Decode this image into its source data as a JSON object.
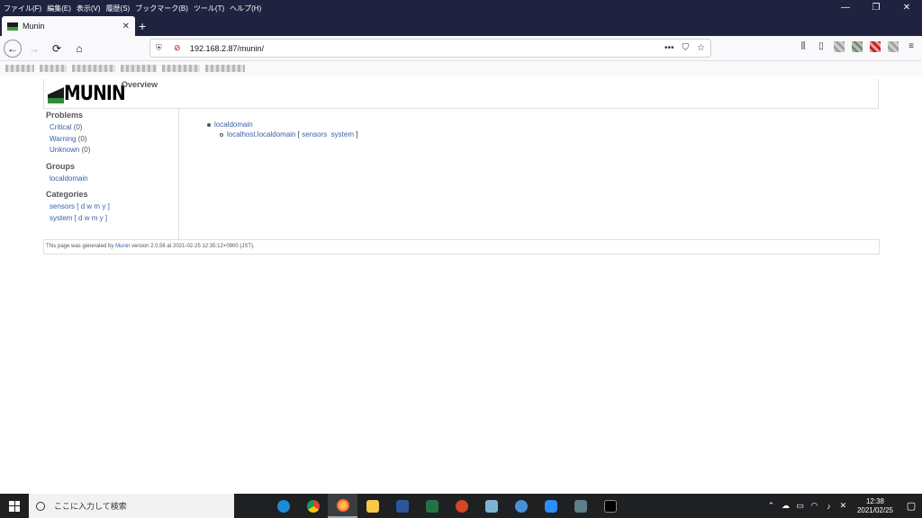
{
  "menubar": {
    "items": [
      "ファイル(F)",
      "編集(E)",
      "表示(V)",
      "履歴(S)",
      "ブックマーク(B)",
      "ツール(T)",
      "ヘルプ(H)"
    ],
    "minimize": "—",
    "restore": "❐",
    "close": "✕"
  },
  "tab": {
    "title": "Munin",
    "close": "✕",
    "new_tab": "+"
  },
  "nav": {
    "back": "←",
    "forward": "→",
    "reload": "⟳",
    "home": "⌂",
    "url": "192.168.2.87/munin/",
    "more": "•••",
    "pocket": "⛉",
    "bookmark": "☆"
  },
  "page": {
    "logo_text": "MUNIN",
    "title": "Overview",
    "sidebar": {
      "problems_heading": "Problems",
      "critical_label": "Critical",
      "critical_count": "(0)",
      "warning_label": "Warning",
      "warning_count": "(0)",
      "unknown_label": "Unknown",
      "unknown_count": "(0)",
      "groups_heading": "Groups",
      "group_item": "localdomain",
      "categories_heading": "Categories",
      "categories": [
        {
          "name": "sensors",
          "open": "[",
          "d": "d",
          "w": "w",
          "m": "m",
          "y": "y",
          "close": "]"
        },
        {
          "name": "system",
          "open": "[",
          "d": "d",
          "w": "w",
          "m": "m",
          "y": "y",
          "close": "]"
        }
      ]
    },
    "tree": {
      "domain": "localdomain",
      "host": "localhost.localdomain",
      "open": "[",
      "cat1": "sensors",
      "cat2": "system",
      "close": "]"
    },
    "footer": {
      "prefix": "This page was generated by",
      "link": "Munin",
      "suffix": "version 2.0.56 at 2021-02-25 12:35:12+0900 (JST)."
    }
  },
  "taskbar": {
    "search_placeholder": "ここに入力して検索",
    "time": "12:38",
    "date": "2021/02/25"
  }
}
